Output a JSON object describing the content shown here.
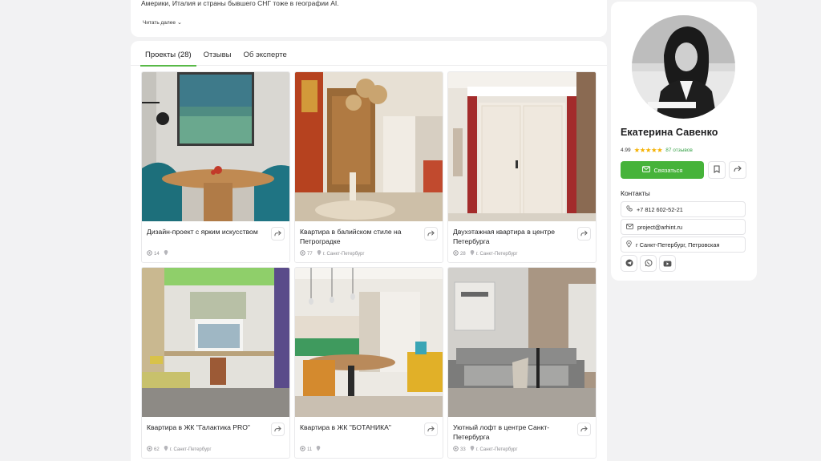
{
  "about": {
    "text": "Америки, Италия и страны бывшего СНГ тоже в географии AI.",
    "read_more": "Читать далее",
    "read_more_arrow": "⌄"
  },
  "tabs": [
    {
      "label": "Проекты (28)",
      "active": true
    },
    {
      "label": "Отзывы",
      "active": false
    },
    {
      "label": "Об эксперте",
      "active": false
    }
  ],
  "projects": [
    {
      "title": "Дизайн-проект с ярким искусством",
      "views": "14",
      "location": ""
    },
    {
      "title": "Квартира в балийском стиле на Петроградке",
      "views": "77",
      "location": "г. Санкт-Петербург"
    },
    {
      "title": "Двухэтажная квартира в центре Петербурга",
      "views": "28",
      "location": "г. Санкт-Петербург"
    },
    {
      "title": "Квартира в ЖК \"Галактика PRO\"",
      "views": "62",
      "location": "г. Санкт-Петербург"
    },
    {
      "title": "Квартира в ЖК \"БОТАНИКА\"",
      "views": "11",
      "location": ""
    },
    {
      "title": "Уютный лофт в центре Санкт-Петербурга",
      "views": "33",
      "location": "г. Санкт-Петербург"
    }
  ],
  "profile": {
    "name": "Екатерина Савенко",
    "rating": "4.99",
    "stars": "★★★★★",
    "reviews": "87 отзывов",
    "contact_button": "Связаться",
    "contacts_heading": "Контакты",
    "phone": "+7 812 602-52-21",
    "email": "project@arhint.ru",
    "address": "г Санкт-Петербург, Петровская"
  },
  "icons": {
    "share": "share-icon",
    "bookmark": "bookmark-icon",
    "eye": "eye-icon",
    "location": "location-pin-icon",
    "mail": "mail-icon",
    "phone": "phone-icon",
    "telegram": "telegram-icon",
    "whatsapp": "whatsapp-icon",
    "youtube": "youtube-icon"
  },
  "colors": {
    "accent": "#46b33a",
    "tab_underline": "#58b947",
    "stars": "#f5b100",
    "background": "#f2f2f3"
  }
}
